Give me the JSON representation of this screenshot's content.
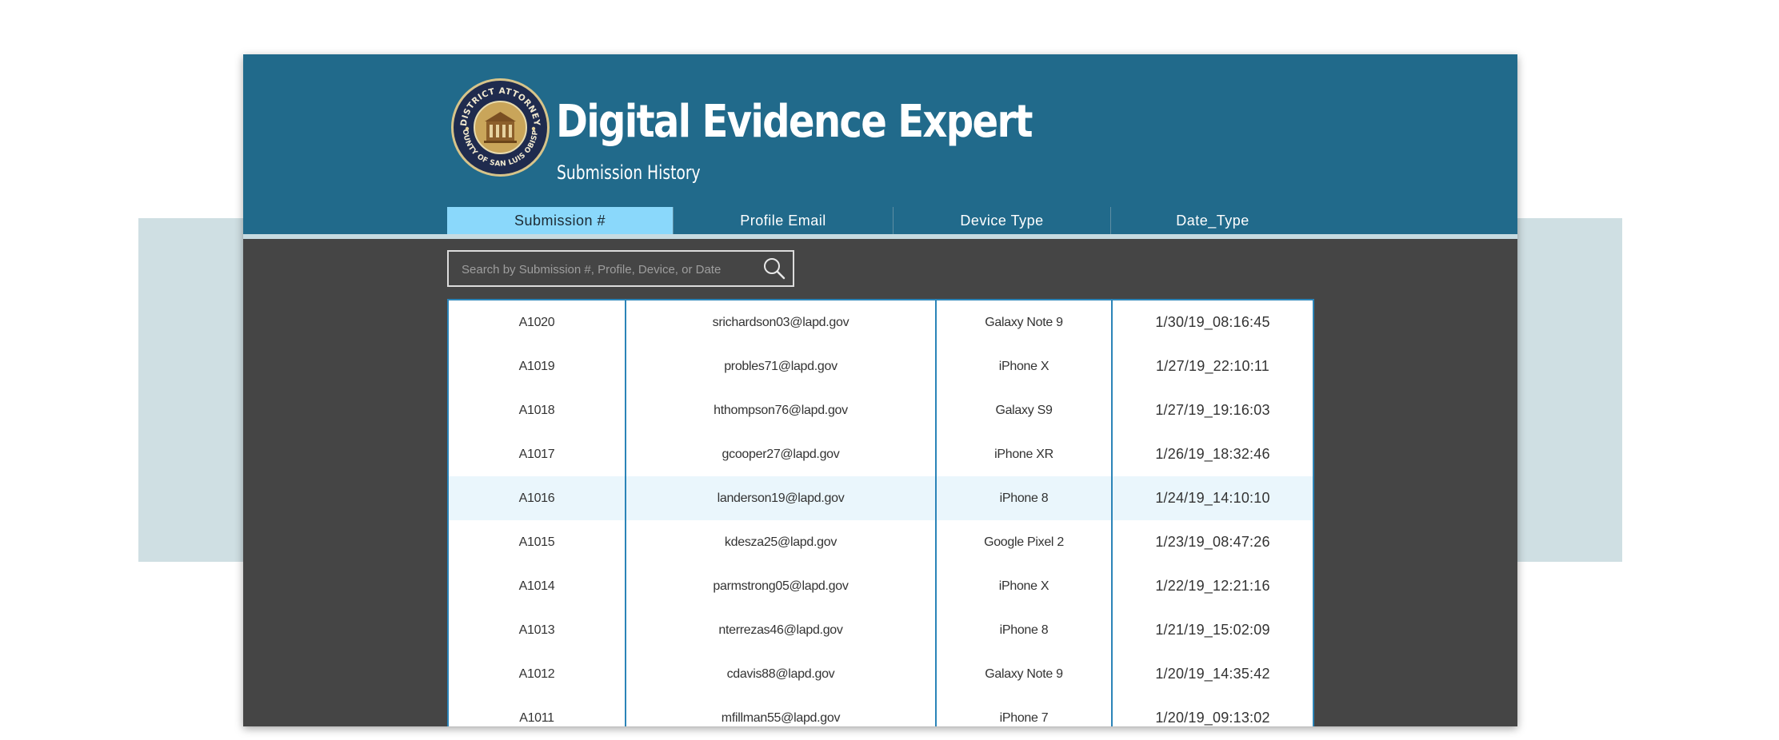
{
  "header": {
    "title": "Digital Evidence Expert",
    "subtitle": "Submission History",
    "seal": {
      "top_text": "DISTRICT ATTORNEY",
      "bottom_text": "COUNTY OF SAN LUIS OBISPO"
    }
  },
  "tabs": [
    {
      "label": "Submission #",
      "active": true
    },
    {
      "label": "Profile Email",
      "active": false
    },
    {
      "label": "Device Type",
      "active": false
    },
    {
      "label": "Date_Type",
      "active": false
    }
  ],
  "search": {
    "placeholder": "Search by Submission #, Profile, Device, or Date"
  },
  "rows": [
    {
      "submission": "A1020",
      "email": "srichardson03@lapd.gov",
      "device": "Galaxy Note 9",
      "date": "1/30/19_08:16:45"
    },
    {
      "submission": "A1019",
      "email": "probles71@lapd.gov",
      "device": "iPhone X",
      "date": "1/27/19_22:10:11"
    },
    {
      "submission": "A1018",
      "email": "hthompson76@lapd.gov",
      "device": "Galaxy S9",
      "date": "1/27/19_19:16:03"
    },
    {
      "submission": "A1017",
      "email": "gcooper27@lapd.gov",
      "device": "iPhone XR",
      "date": "1/26/19_18:32:46"
    },
    {
      "submission": "A1016",
      "email": "landerson19@lapd.gov",
      "device": "iPhone 8",
      "date": "1/24/19_14:10:10",
      "highlighted": true
    },
    {
      "submission": "A1015",
      "email": "kdeszа25@lapd.gov",
      "device": "Google Pixel 2",
      "date": "1/23/19_08:47:26"
    },
    {
      "submission": "A1014",
      "email": "parmstrong05@lapd.gov",
      "device": "iPhone X",
      "date": "1/22/19_12:21:16"
    },
    {
      "submission": "A1013",
      "email": "nterrezas46@lapd.gov",
      "device": "iPhone 8",
      "date": "1/21/19_15:02:09"
    },
    {
      "submission": "A1012",
      "email": "cdavis88@lapd.gov",
      "device": "Galaxy Note 9",
      "date": "1/20/19_14:35:42"
    },
    {
      "submission": "A1011",
      "email": "mfillman55@lapd.gov",
      "device": "iPhone 7",
      "date": "1/20/19_09:13:02"
    }
  ],
  "colors": {
    "header_bg": "#216a8b",
    "active_tab": "#8ad8fb",
    "body_bg": "#454545",
    "table_border": "#2b84b8",
    "row_highlight": "#eaf6fc"
  }
}
